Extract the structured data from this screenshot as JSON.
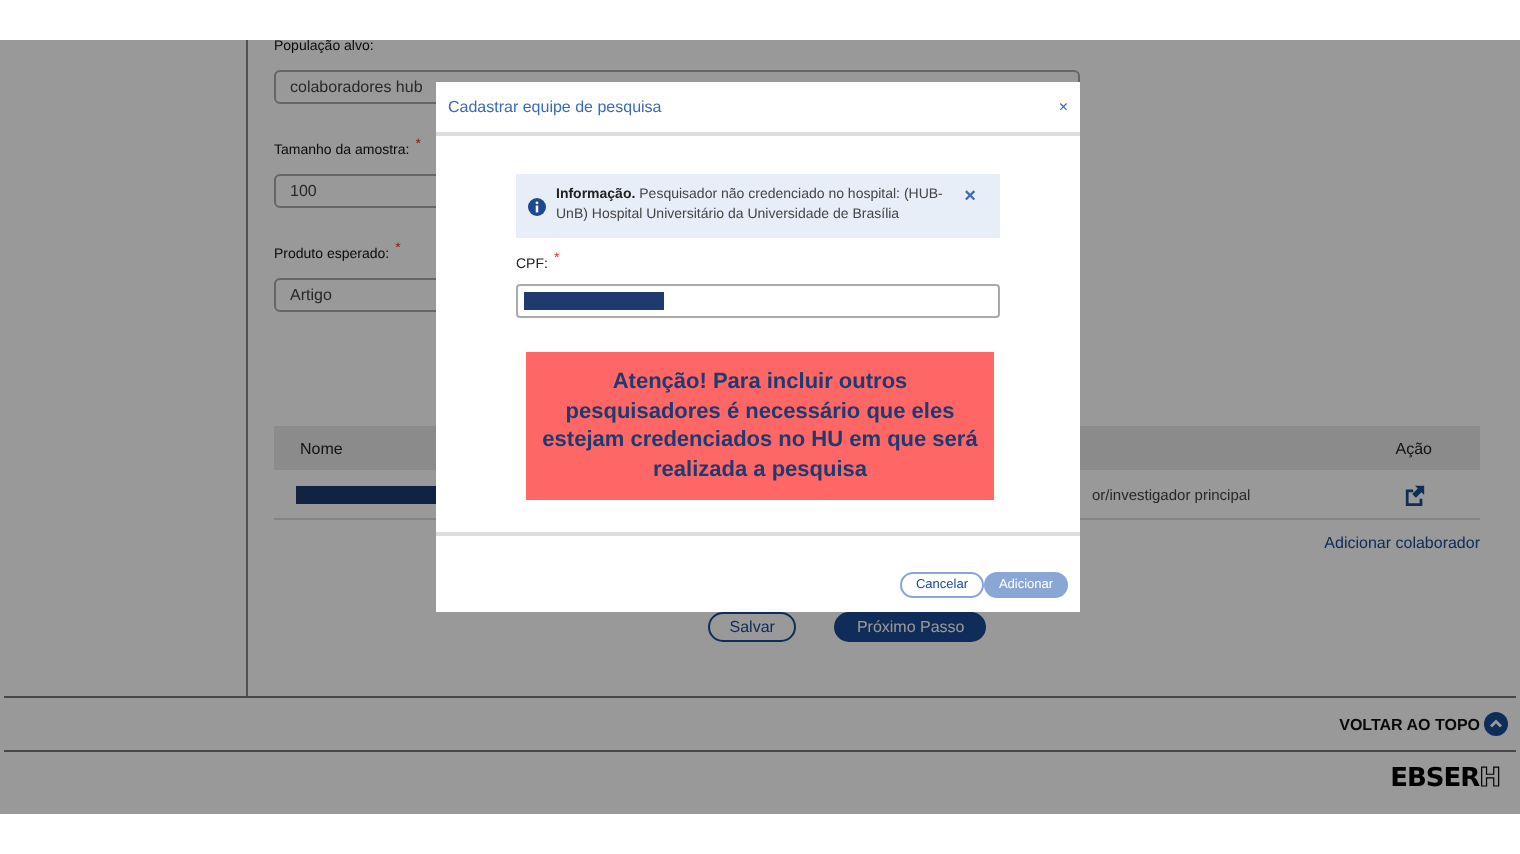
{
  "form": {
    "fields": [
      {
        "label": "População alvo:",
        "value": "colaboradores hub"
      },
      {
        "label": "Tamanho da amostra:",
        "required_mark": "*",
        "value": "100"
      },
      {
        "label": "Produto esperado:",
        "required_mark": "*",
        "value": "Artigo"
      }
    ]
  },
  "team_table": {
    "columns": [
      "Nome",
      "Ação"
    ],
    "rows": [
      {
        "column_2": "or/investigador principal"
      }
    ]
  },
  "add_collaborator_link": "Adicionar colaborador",
  "buttons": [
    {
      "label": "Salvar",
      "kind": "outline"
    },
    {
      "label": "Próximo Passo",
      "kind": "primary"
    }
  ],
  "back_to_top": "VOLTAR AO TOPO",
  "footer_logo": {
    "text": "EBSER",
    "accent": "H"
  },
  "modal": {
    "title": "Cadastrar equipe de pesquisa",
    "close": "×",
    "alert": {
      "title": "Informação.",
      "text": "Pesquisador não credenciado no hospital: (HUB-UnB) Hospital Universitário da Universidade de Brasília",
      "close": "×"
    },
    "cpf_field": {
      "label": "CPF:",
      "required_mark": "*"
    },
    "warning": "Atenção! Para incluir outros pesquisadores é necessário que eles estejam credenciados no HU em que será realizada a pesquisa",
    "buttons": [
      {
        "label": "Cancelar",
        "kind": "outline",
        "disabled": false
      },
      {
        "label": "Adicionar",
        "kind": "primary",
        "disabled": true
      }
    ]
  }
}
